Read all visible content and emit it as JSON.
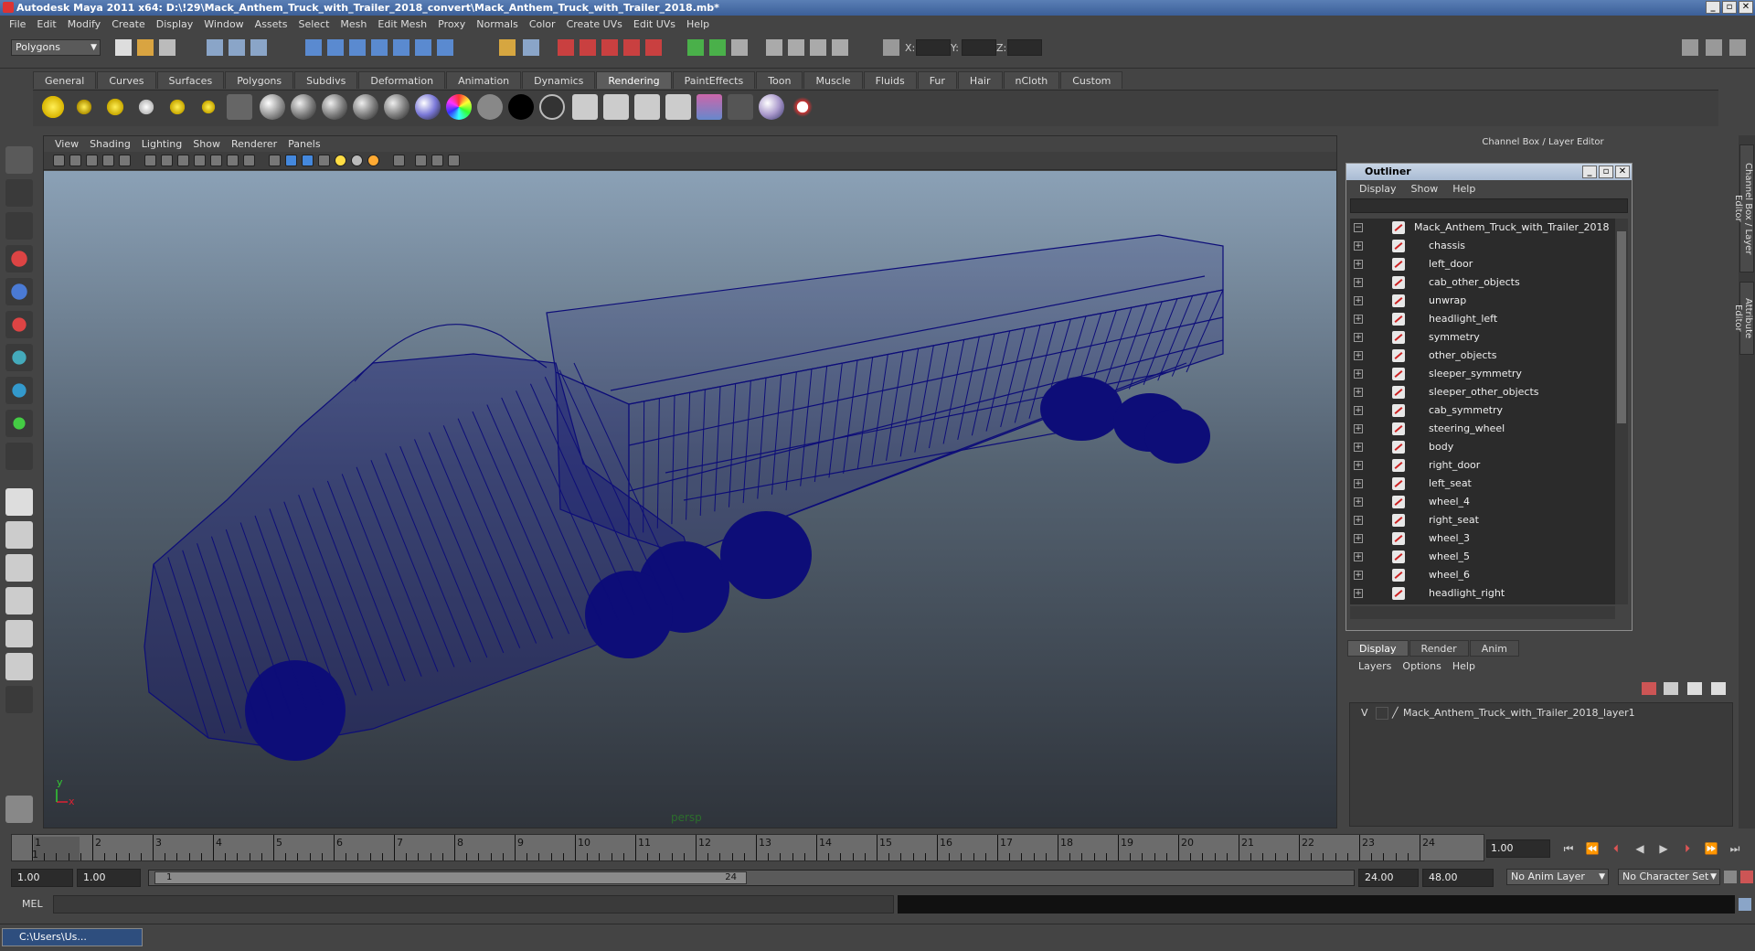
{
  "window": {
    "title": "Autodesk Maya 2011 x64: D:\\!29\\Mack_Anthem_Truck_with_Trailer_2018_convert\\Mack_Anthem_Truck_with_Trailer_2018.mb*"
  },
  "menubar": [
    "File",
    "Edit",
    "Modify",
    "Create",
    "Display",
    "Window",
    "Assets",
    "Select",
    "Mesh",
    "Edit Mesh",
    "Proxy",
    "Normals",
    "Color",
    "Create UVs",
    "Edit UVs",
    "Help"
  ],
  "statusline": {
    "mode": "Polygons",
    "x_label": "X:",
    "y_label": "Y:",
    "z_label": "Z:"
  },
  "shelf": {
    "tabs": [
      "General",
      "Curves",
      "Surfaces",
      "Polygons",
      "Subdivs",
      "Deformation",
      "Animation",
      "Dynamics",
      "Rendering",
      "PaintEffects",
      "Toon",
      "Muscle",
      "Fluids",
      "Fur",
      "Hair",
      "nCloth",
      "Custom"
    ],
    "active_tab": "Rendering"
  },
  "viewport": {
    "menu": [
      "View",
      "Shading",
      "Lighting",
      "Show",
      "Renderer",
      "Panels"
    ],
    "camera_label": "persp",
    "axis_y": "y",
    "axis_x": "x",
    "wire_color": "#0d0d78"
  },
  "channel_box": {
    "title": "Channel Box / Layer Editor"
  },
  "outliner": {
    "title": "Outliner",
    "menu": [
      "Display",
      "Show",
      "Help"
    ],
    "root": "Mack_Anthem_Truck_with_Trailer_2018",
    "items": [
      "chassis",
      "left_door",
      "cab_other_objects",
      "unwrap",
      "headlight_left",
      "symmetry",
      "other_objects",
      "sleeper_symmetry",
      "sleeper_other_objects",
      "cab_symmetry",
      "steering_wheel",
      "body",
      "right_door",
      "left_seat",
      "wheel_4",
      "right_seat",
      "wheel_3",
      "wheel_5",
      "wheel_6",
      "headlight_right"
    ]
  },
  "layer_editor": {
    "tabs": [
      "Display",
      "Render",
      "Anim"
    ],
    "active_tab": "Display",
    "menu": [
      "Layers",
      "Options",
      "Help"
    ],
    "layer": {
      "visible": "V",
      "name": "Mack_Anthem_Truck_with_Trailer_2018_layer1"
    }
  },
  "side_tabs": [
    "Channel Box / Layer Editor",
    "Attribute Editor"
  ],
  "timeline": {
    "ticks": [
      "1",
      "2",
      "3",
      "4",
      "5",
      "6",
      "7",
      "8",
      "9",
      "10",
      "11",
      "12",
      "13",
      "14",
      "15",
      "16",
      "17",
      "18",
      "19",
      "20",
      "21",
      "22",
      "23",
      "24"
    ],
    "current_frame_marker": "1",
    "current_frame": "1.00"
  },
  "range": {
    "start": "1.00",
    "anim_start": "1.00",
    "thumb_start": "1",
    "thumb_end": "24",
    "end": "24.00",
    "anim_end": "48.00",
    "anim_layer": "No Anim Layer",
    "character_set": "No Character Set"
  },
  "commandline": {
    "label": "MEL"
  },
  "taskbar": {
    "item": "C:\\Users\\Us..."
  }
}
